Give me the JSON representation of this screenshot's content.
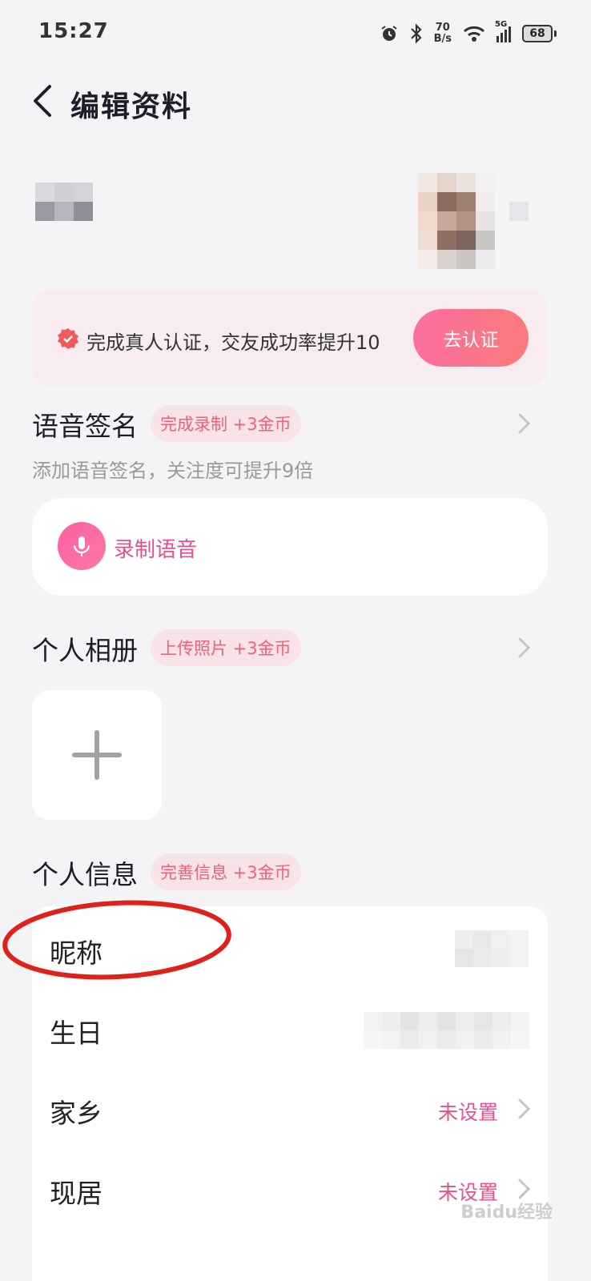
{
  "status_bar": {
    "time": "15:27",
    "net_speed_value": "70",
    "net_speed_unit": "B/s",
    "network": "5G",
    "battery": "68"
  },
  "header": {
    "title": "编辑资料"
  },
  "verify_banner": {
    "text": "完成真人认证，交友成功率提升10",
    "button": "去认证"
  },
  "voice_signature": {
    "title": "语音签名",
    "badge": "完成录制 +3金币",
    "subtitle": "添加语音签名，关注度可提升9倍",
    "record_label": "录制语音"
  },
  "album": {
    "title": "个人相册",
    "badge": "上传照片 +3金币"
  },
  "personal_info": {
    "title": "个人信息",
    "badge": "完善信息 +3金币",
    "rows": [
      {
        "label": "昵称",
        "value": ""
      },
      {
        "label": "生日",
        "value": ""
      },
      {
        "label": "家乡",
        "value": "未设置"
      },
      {
        "label": "现居",
        "value": "未设置"
      }
    ]
  },
  "watermark": "Baidu经验",
  "colors": {
    "accent": "#e5508f",
    "badge_text": "#f0607a",
    "highlight_ellipse": "#e0201a"
  }
}
